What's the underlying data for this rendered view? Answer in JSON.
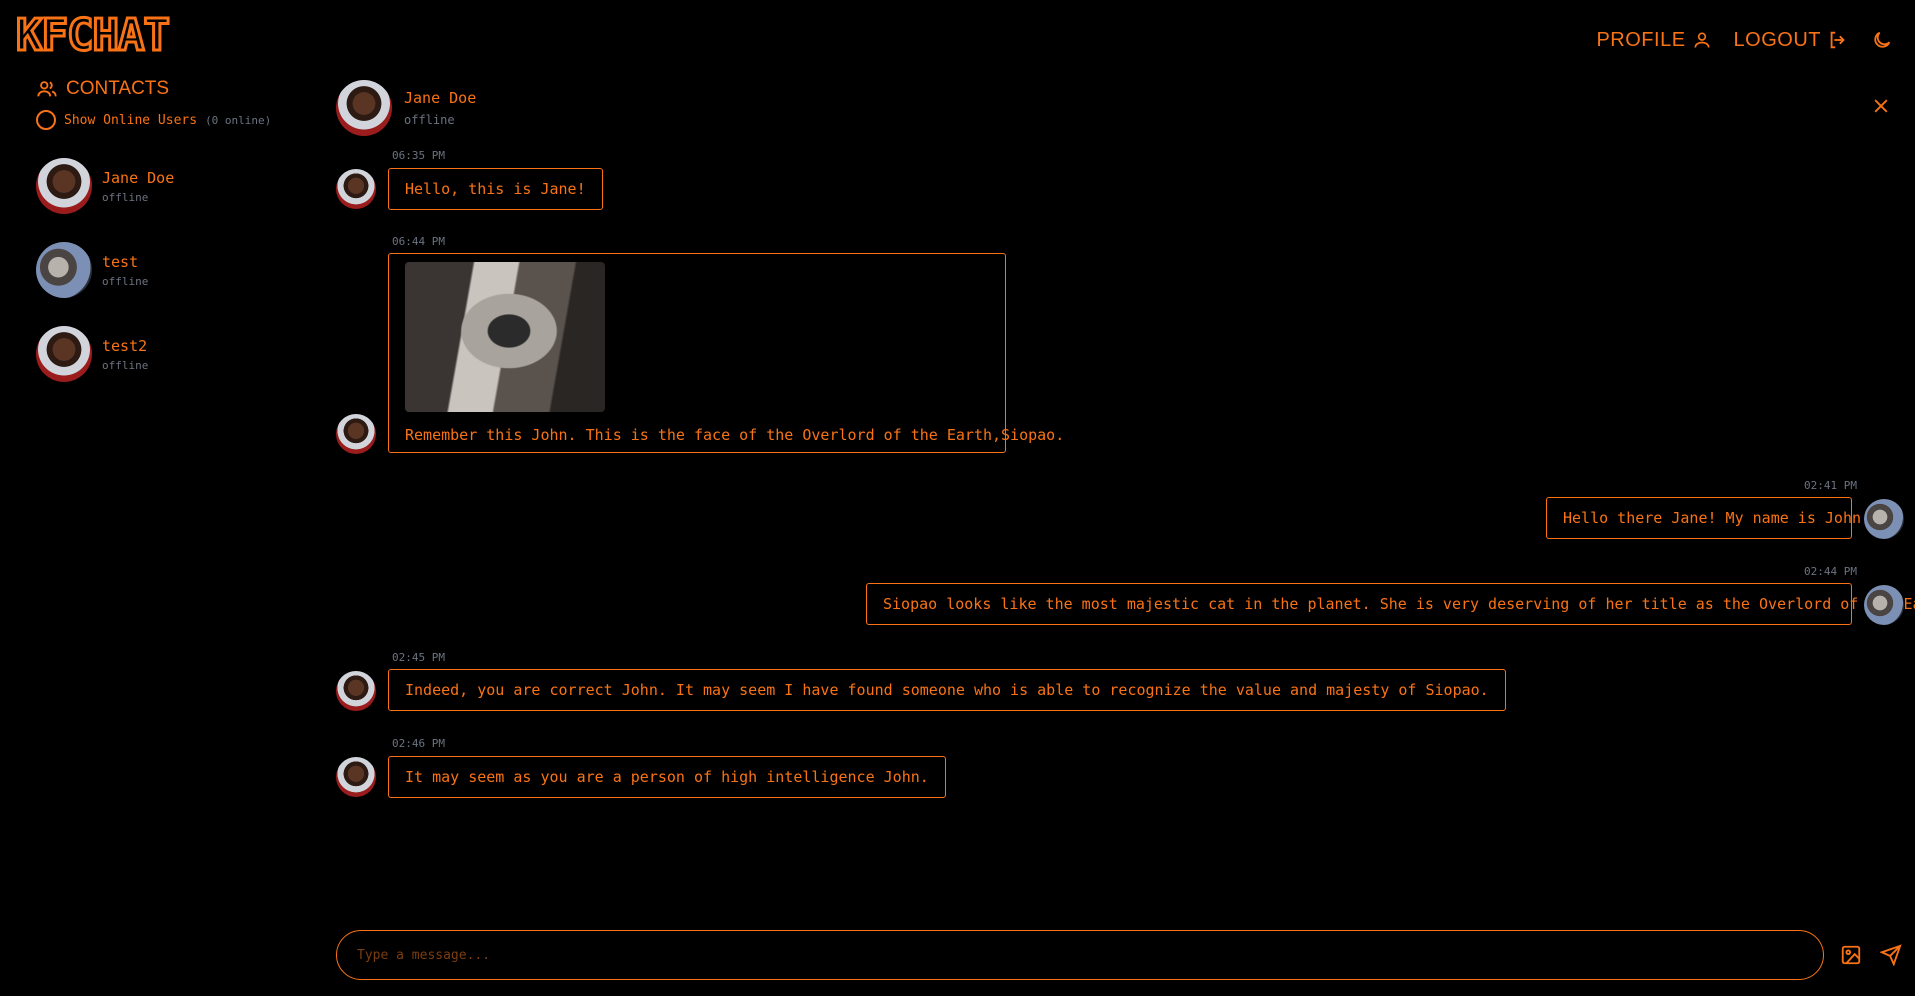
{
  "app": {
    "logo_text": "KFCHAT"
  },
  "nav": {
    "profile_label": "PROFILE",
    "logout_label": "LOGOUT",
    "theme_icon": "moon-icon"
  },
  "sidebar": {
    "title": "CONTACTS",
    "online_toggle_label": "Show Online Users",
    "online_count": "(0 online)",
    "contacts": [
      {
        "name": "Jane Doe",
        "status": "offline",
        "avatar": "portrait"
      },
      {
        "name": "test",
        "status": "offline",
        "avatar": "cat-photo"
      },
      {
        "name": "test2",
        "status": "offline",
        "avatar": "portrait"
      }
    ]
  },
  "chat": {
    "contact_name": "Jane Doe",
    "contact_status": "offline",
    "messages": [
      {
        "time": "06:35 PM",
        "text": "Hello, this is Jane!",
        "from": "contact"
      },
      {
        "time": "06:44 PM",
        "text": "Remember this John. This is the face of the Overlord of the Earth,Siopao.",
        "from": "contact",
        "has_image": true
      },
      {
        "time": "02:41 PM",
        "text": "Hello there Jane! My name is John.",
        "from": "me"
      },
      {
        "time": "02:44 PM",
        "text": "Siopao looks like the most majestic cat in the planet. She is very deserving of her title as the Overlord of the Earth!",
        "from": "me"
      },
      {
        "time": "02:45 PM",
        "text": "Indeed, you are correct John. It may seem I have found someone who is able to recognize the value and majesty of Siopao.",
        "from": "contact"
      },
      {
        "time": "02:46 PM",
        "text": "It may seem as you are a person of high intelligence John.",
        "from": "contact"
      }
    ]
  },
  "composer": {
    "placeholder": "Type a message..."
  },
  "colors": {
    "accent": "#f97316",
    "background": "#000000",
    "muted": "#6b7280"
  }
}
